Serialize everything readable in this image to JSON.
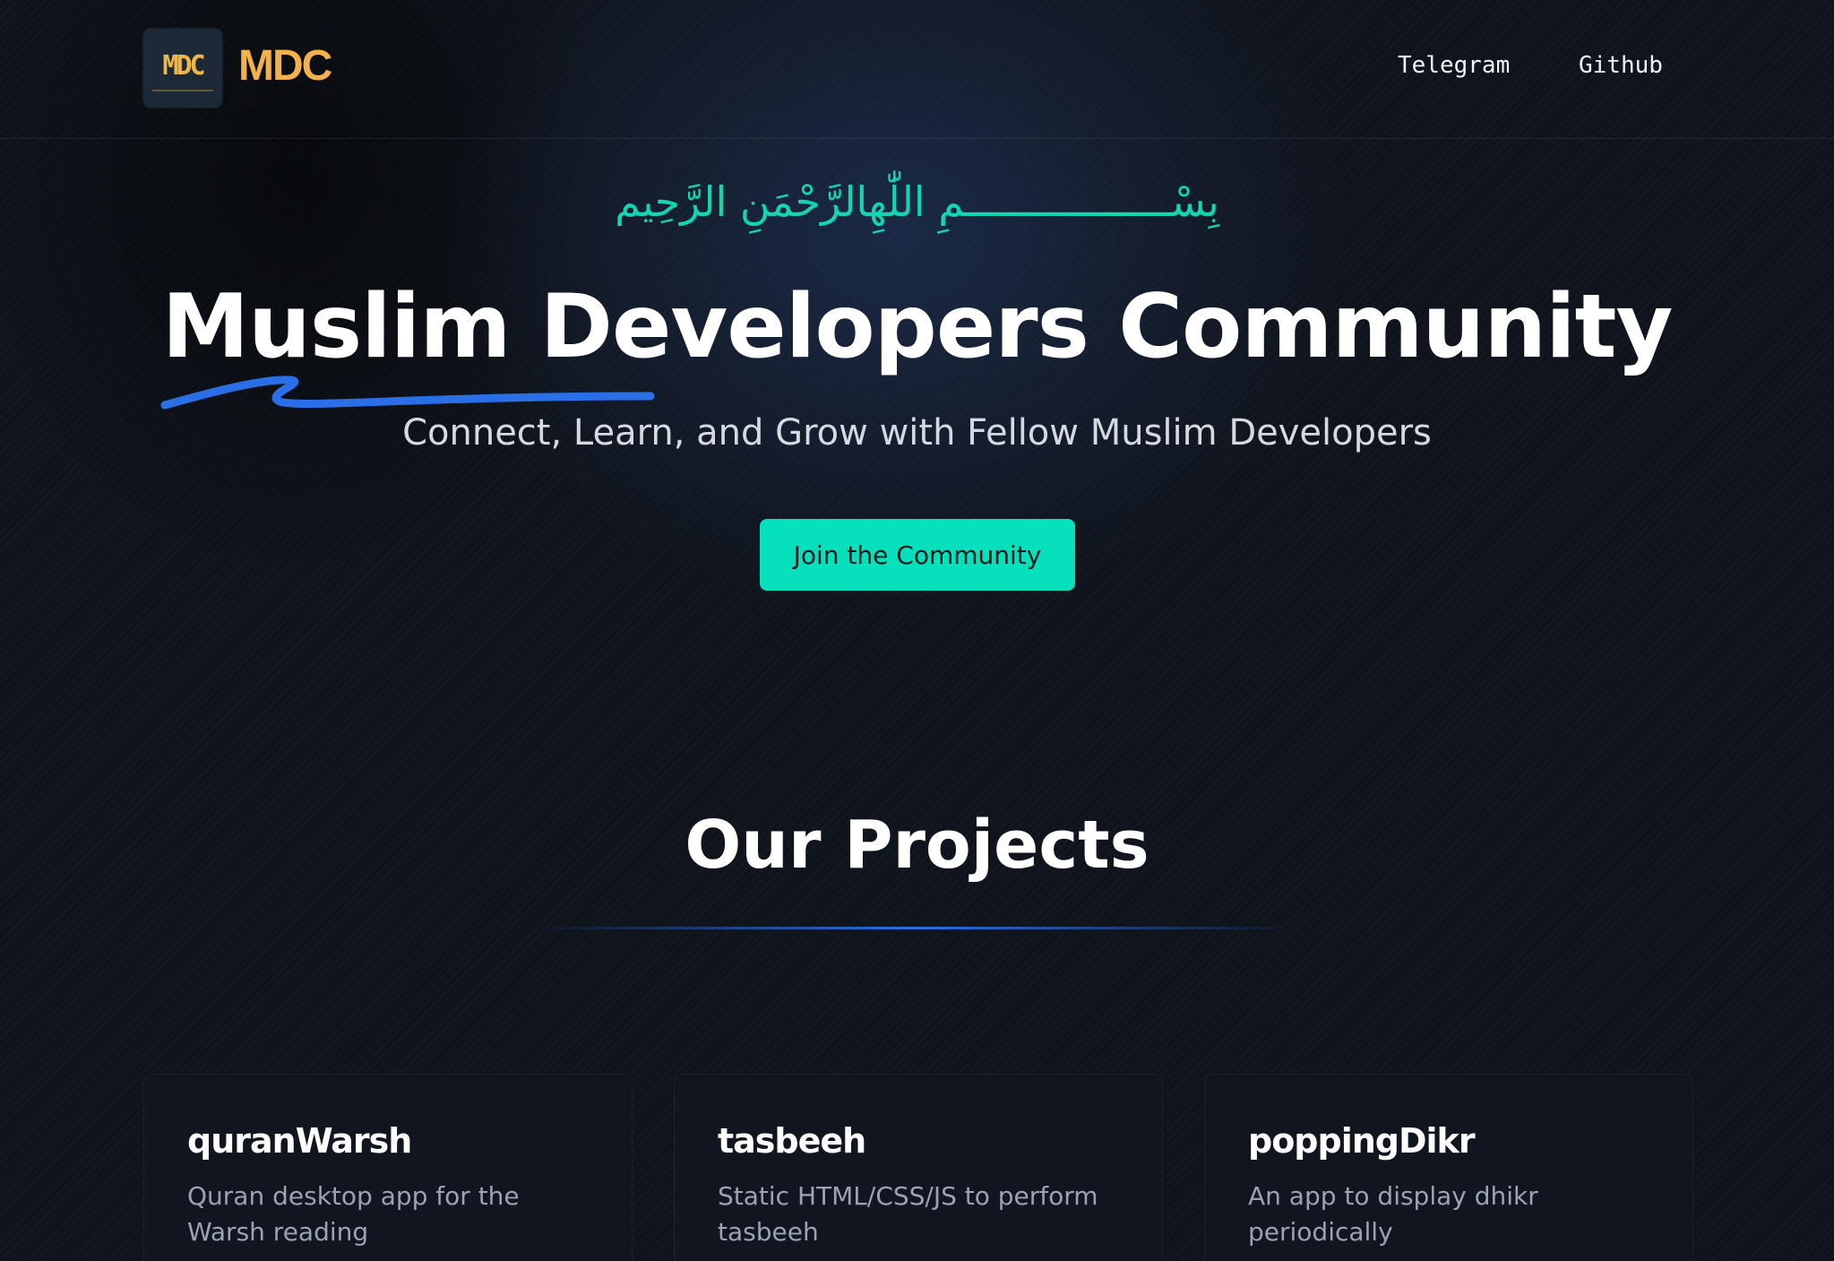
{
  "header": {
    "logo_text": "MDC",
    "brand_name": "MDC",
    "nav": [
      {
        "label": "Telegram"
      },
      {
        "label": "Github"
      }
    ]
  },
  "hero": {
    "bismillah": "بِسْـــــــــــــــــمِ اللّٰهِالرَّحْمَنِ الرَّحِيم",
    "title": "Muslim Developers Community",
    "subtitle": "Connect, Learn, and Grow with Fellow Muslim Developers",
    "cta_label": "Join the Community"
  },
  "projects": {
    "heading": "Our Projects",
    "items": [
      {
        "name": "quranWarsh",
        "description": "Quran desktop app for the Warsh reading"
      },
      {
        "name": "tasbeeh",
        "description": "Static HTML/CSS/JS to perform tasbeeh"
      },
      {
        "name": "poppingDikr",
        "description": "An app to display dhikr periodically"
      }
    ]
  },
  "colors": {
    "accent": "#06e0bd",
    "brand": "#f2b14a",
    "underline": "#2b6fe8",
    "background": "#0f141c"
  }
}
